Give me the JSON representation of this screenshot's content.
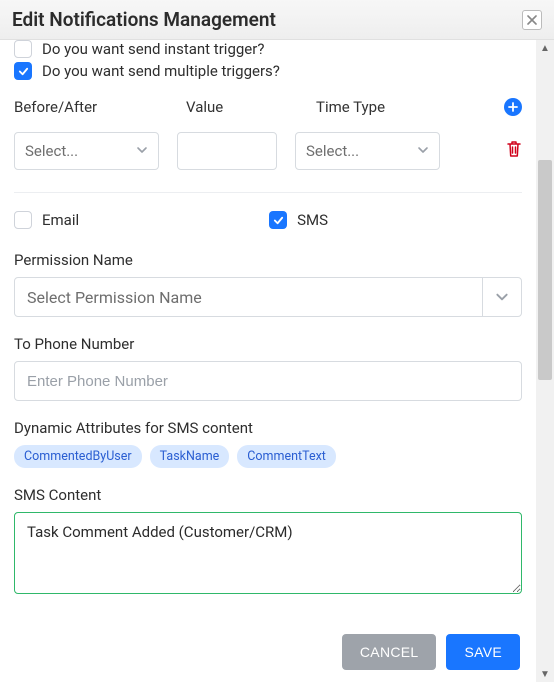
{
  "header": {
    "title": "Edit Notifications Management"
  },
  "instantTrigger": {
    "label": "Do you want send instant trigger?",
    "checked": false
  },
  "multipleTrigger": {
    "label": "Do you want send multiple triggers?",
    "checked": true
  },
  "triggerColumns": {
    "before": "Before/After",
    "value": "Value",
    "timeType": "Time Type"
  },
  "triggerRow": {
    "beforePlaceholder": "Select...",
    "valuePlaceholder": "",
    "timeTypePlaceholder": "Select..."
  },
  "channels": {
    "emailLabel": "Email",
    "emailChecked": false,
    "smsLabel": "SMS",
    "smsChecked": true
  },
  "permission": {
    "label": "Permission Name",
    "placeholder": "Select Permission Name"
  },
  "phone": {
    "label": "To Phone Number",
    "placeholder": "Enter Phone Number",
    "value": ""
  },
  "dynamic": {
    "label": "Dynamic Attributes for SMS content",
    "chips": [
      "CommentedByUser",
      "TaskName",
      "CommentText"
    ]
  },
  "smsContent": {
    "label": "SMS Content",
    "value": "Task Comment Added (Customer/CRM)"
  },
  "footer": {
    "cancel": "CANCEL",
    "save": "SAVE"
  }
}
